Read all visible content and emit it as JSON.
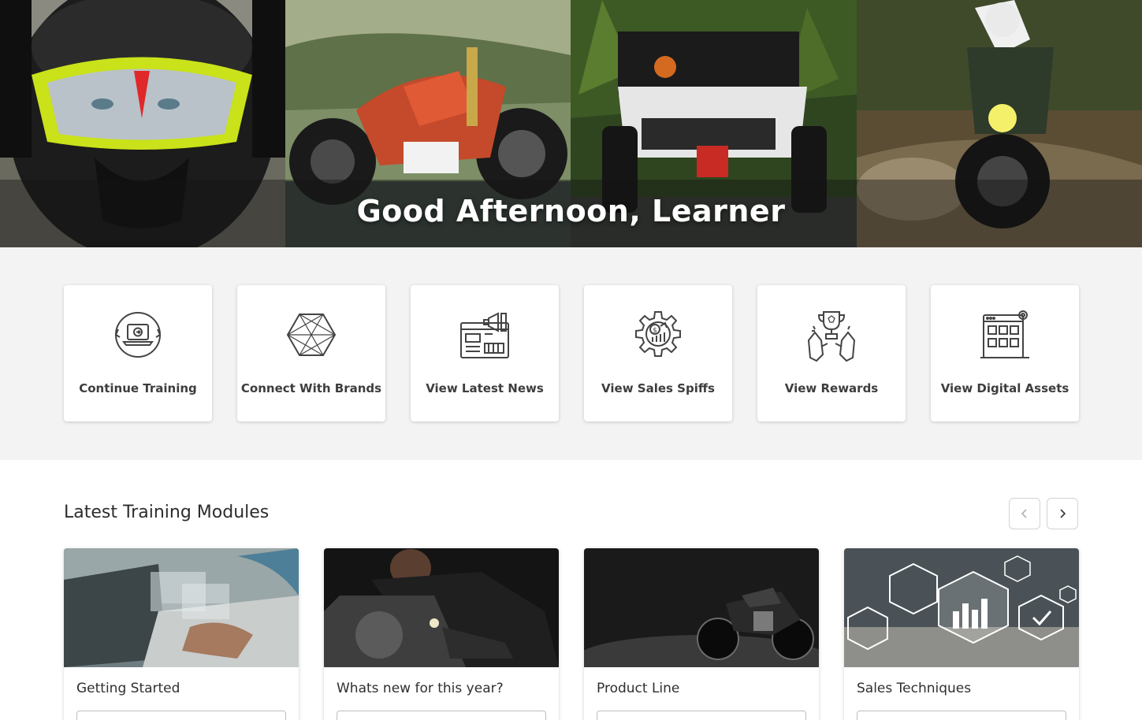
{
  "hero": {
    "greeting": "Good Afternoon, Learner"
  },
  "quick_links": [
    {
      "label": "Continue Training",
      "icon": "laptop-play-icon"
    },
    {
      "label": "Connect With Brands",
      "icon": "network-hexagon-icon"
    },
    {
      "label": "View Latest News",
      "icon": "newspaper-megaphone-icon"
    },
    {
      "label": "View Sales Spiffs",
      "icon": "gear-dollar-icon"
    },
    {
      "label": "View Rewards",
      "icon": "trophy-hands-icon"
    },
    {
      "label": "View Digital Assets",
      "icon": "digital-assets-icon"
    }
  ],
  "modules": {
    "title": "Latest Training Modules",
    "items": [
      {
        "label": "Getting Started"
      },
      {
        "label": "Whats new for this year?"
      },
      {
        "label": "Product Line"
      },
      {
        "label": "Sales Techniques"
      }
    ]
  },
  "colors": {
    "quick_bg": "#f3f3f3",
    "icon_stroke": "#444444",
    "text": "#333333"
  }
}
